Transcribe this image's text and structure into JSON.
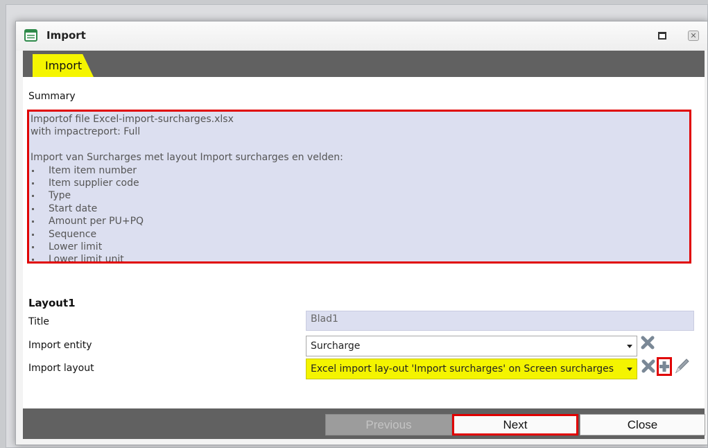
{
  "window": {
    "title": "Import"
  },
  "tabs": [
    {
      "label": "Import"
    }
  ],
  "summary": {
    "label": "Summary",
    "lines": [
      "Importof file Excel-import-surcharges.xlsx",
      "with impactreport: Full",
      "",
      "Import van Surcharges met layout Import surcharges en velden:"
    ],
    "fields": [
      "Item item number",
      "Item supplier code",
      "Type",
      "Start date",
      "Amount per PU+PQ",
      "Sequence",
      "Lower limit",
      "Lower limit unit"
    ]
  },
  "layout_section": {
    "heading": "Layout1",
    "title_label": "Title",
    "title_value": "Blad1",
    "entity_label": "Import entity",
    "entity_value": "Surcharge",
    "layout_label": "Import layout",
    "layout_value": "Excel import lay-out 'Import surcharges' on Screen surcharges"
  },
  "footer": {
    "previous_label": "Previous",
    "next_label": "Next",
    "close_label": "Close"
  },
  "colors": {
    "highlight_red": "#e00000",
    "tab_yellow": "#f5f500",
    "summary_bg": "#dcdff0",
    "dark_bar": "#616161"
  },
  "icons": [
    "form-icon",
    "maximize-icon",
    "close-icon",
    "clear-icon",
    "add-icon",
    "edit-icon",
    "dropdown-caret-icon"
  ]
}
